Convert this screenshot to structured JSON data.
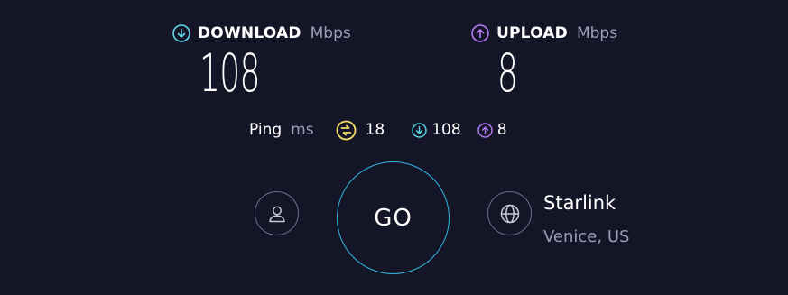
{
  "download": {
    "label": "DOWNLOAD",
    "unit": "Mbps",
    "value": "108",
    "icon": "download-arrow-icon",
    "color": "#5fd9e8"
  },
  "upload": {
    "label": "UPLOAD",
    "unit": "Mbps",
    "value": "8",
    "icon": "upload-arrow-icon",
    "color": "#b57cf5"
  },
  "ping": {
    "label": "Ping",
    "unit": "ms",
    "idle_value": "18",
    "idle_icon": "ping-latency-icon",
    "idle_color": "#f5e16a",
    "download_value": "108",
    "download_icon": "download-latency-icon",
    "upload_value": "8",
    "upload_icon": "upload-latency-icon"
  },
  "go_button": {
    "label": "GO",
    "ring_color": "#2eb7e3"
  },
  "account": {
    "icon": "user-icon"
  },
  "provider": {
    "icon": "globe-icon",
    "name": "Starlink",
    "location": "Venice, US"
  }
}
